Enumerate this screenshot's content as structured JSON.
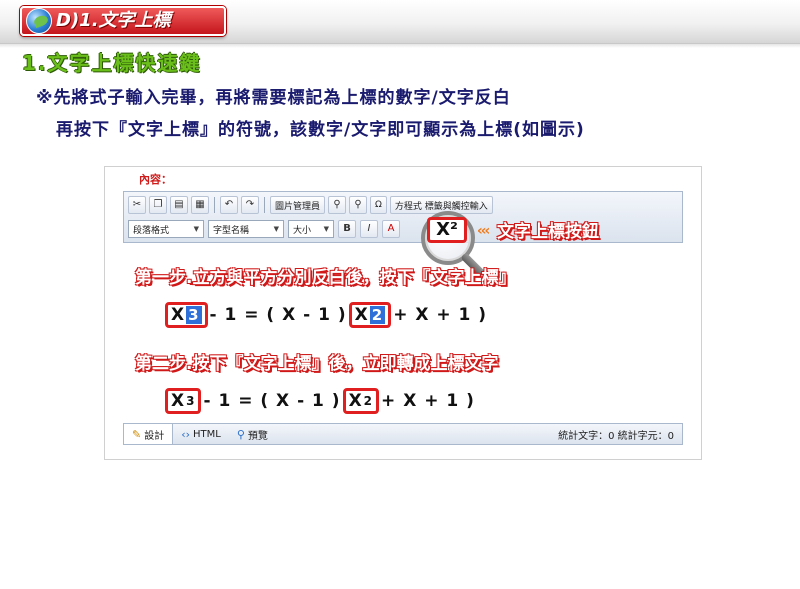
{
  "header": {
    "title": "D)1.文字上標"
  },
  "section": {
    "heading": "1.文字上標快速鍵"
  },
  "instructions": {
    "line1": "※先將式子輸入完畢，再將需要標記為上標的數字/文字反白",
    "line2": "再按下『文字上標』的符號，該數字/文字即可顯示為上標(如圖示)"
  },
  "editor": {
    "content_label": "內容：",
    "toolbar": {
      "row1": {
        "image_manager": "圖片管理員",
        "omega": "Ω",
        "formula_and_tabs": "方程式  標籤與觸控輸入"
      },
      "row2": {
        "paragraph_select": "段落格式",
        "font_select": "字型名稱",
        "size_select": "大小",
        "bold": "B",
        "italic": "I",
        "font_color": "A"
      }
    },
    "superscript_button": "X²",
    "callout_arrows": "‹‹‹",
    "callout_label": "文字上標按鈕",
    "step1": {
      "label": "第一步.立方與平方分別反白後，按下『文字上標』",
      "x1": "X",
      "exp1": "3",
      "mid": "- 1 = ( X - 1 )",
      "x2": "X",
      "exp2": "2",
      "tail": "+ X + 1 )"
    },
    "step2": {
      "label": "第二步.按下『文字上標』後，立即轉成上標文字",
      "x1": "X",
      "exp1": "3",
      "mid": "- 1 = ( X - 1 )",
      "x2": "X",
      "exp2": "2",
      "tail": "+ X + 1 )"
    },
    "statusbar": {
      "design": "設計",
      "html": "HTML",
      "preview": "預覽",
      "counts": "統計文字：0  統計字元：0"
    }
  },
  "colors": {
    "accent_red": "#e02020",
    "heading_green": "#6bbf1a",
    "instruction_navy": "#1a1a6e",
    "highlight_blue": "#2f6fd8"
  },
  "icons": [
    "globe-icon",
    "magnifier-icon",
    "cut-icon",
    "copy-icon",
    "paste-icon",
    "undo-icon",
    "redo-icon",
    "pencil-icon",
    "code-icon",
    "search-icon"
  ]
}
